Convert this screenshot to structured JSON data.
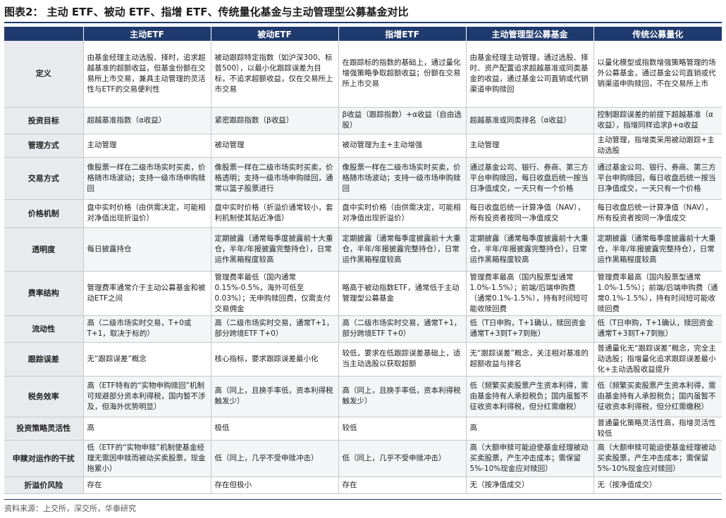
{
  "title": "图表2：  主动 ETF、被动 ETF、指增 ETF、传统量化基金与主动管理型公募基金对比",
  "columns": [
    "",
    "主动ETF",
    "被动ETF",
    "指增ETF",
    "主动管理型公募基金",
    "传统公募量化"
  ],
  "rows": [
    {
      "label": "定义",
      "cells": [
        "由基金经理主动选股、择时，追求超越基准的超额收益，但基金份额在交易所上市交易，兼具主动管理的灵活性与ETF的交易便利性",
        "被动跟踪特定指数（如沪深300、标普500），以最小化跟踪误差为目标，不追求超额收益，仅在交易所上市交易",
        "在跟踪标的指数的基础上，通过量化增强策略争取超额收益；份额在交易所上市交易",
        "由基金经理主动管理，通过选股、择时、资产配置追求超越基准或同类基金的收益，通过基金公司直销或代销渠道申购赎回",
        "以量化模型或指数增强策略管理的场外公募基金，通过基金公司直销或代销渠道申购赎回，不在交易所上市"
      ]
    },
    {
      "label": "投资目标",
      "cells": [
        "超越基准指数（α收益）",
        "紧密跟踪指数（β收益）",
        "β收益（跟踪指数）+α收益（自由选股）",
        "超越基准或同类排名（α收益）",
        "控制跟踪误差的前提下超越基准（α收益），指增同样追求β+α收益"
      ]
    },
    {
      "label": "管理方式",
      "cells": [
        "主动管理",
        "被动管理",
        "被动管理为主+主动增强",
        "主动管理",
        "主动管理，指增类采用被动跟踪+主动选股"
      ]
    },
    {
      "label": "交易方式",
      "cells": [
        "像股票一样在二级市场实时买卖，价格随市场波动；支持一级市场申购赎回",
        "像股票一样在二级市场实时买卖，价格透明；支持一级市场申购赎回，通常以篮子股票进行",
        "像股票一样在二级市场实时买卖，价格随市场波动；支持一级市场申购赎回",
        "通过基金公司、银行、券商、第三方平台申购赎回，每日收盘后统一按当日净值成交，一天只有一个价格",
        "通过基金公司、银行、券商、第三方平台申购赎回，每日收盘后统一按当日净值成交，一天只有一个价格"
      ]
    },
    {
      "label": "价格机制",
      "cells": [
        "盘中实时价格（由供需决定，可能相对净值出现折溢价）",
        "盘中实时价格（折溢价通常较小，套利机制使其贴近净值）",
        "盘中实时价格（由供需决定，可能相对净值出现折溢价）",
        "每日收盘后统一计算净值（NAV），所有投资者按同一净值成交",
        "每日收盘后统一计算净值（NAV），所有投资者按同一净值成交"
      ]
    },
    {
      "label": "透明度",
      "cells": [
        "每日披露持仓",
        "定期披露（通常每季度披露前十大重仓，半年/年报披露完整持仓），日常运作黑箱程度较高",
        "定期披露（通常每季度披露前十大重仓，半年/年报披露完整持仓），日常运作黑箱程度较高",
        "定期披露（通常每季度披露前十大重仓，半年/年报披露完整持仓），日常运作黑箱程度较高",
        "定期披露（通常每季度披露前十大重仓，半年/年报披露完整持仓），日常运作黑箱程度较高"
      ]
    },
    {
      "label": "费率结构",
      "cells": [
        "管理费率通常介于主动公募基金和被动ETF之间",
        "管理费率最低（国内通常0.15%-0.5%，海外可低至0.03%）；无申购赎回费，仅需支付交易佣金",
        "略高于被动指数ETF，通常低于主动管理型公募基金",
        "管理费率最高（国内股票型通常1.0%-1.5%）；前端/后端申购费（通常0.1%-1.5%），持有时间短可能收赎回费",
        "管理费率最高（国内股票型通常1.0%-1.5%）；前端/后端申购费（通常0.1%-1.5%），持有时间短可能收赎回费"
      ]
    },
    {
      "label": "流动性",
      "cells": [
        "高（二级市场实时交易，T+0或T+1，取决于标的）",
        "高（二级市场实时交易，通常T+1，部分跨境ETF T+0）",
        "高（二级市场实时交易，通常T+1，部分跨境ETF T+0）",
        "低（T日申购，T+1确认，赎回资金通常T+3到T+7到账）",
        "低（T日申购，T+1确认，赎回资金通常T+3到T+7到账）"
      ]
    },
    {
      "label": "跟踪误差",
      "cells": [
        "无“跟踪误差”概念",
        "核心指标，要求跟踪误差最小化",
        "较低，要求在低跟踪误差基础上，适当主动选股以获取超额",
        "无“跟踪误差”概念，关注相对基准的超额收益与排名",
        "普通量化无“跟踪误差”概念，完全主动选股；指增量化追求跟踪误差最小化+主动选股收益提升"
      ]
    },
    {
      "label": "税务效率",
      "cells": [
        "高（ETF特有的“实物申购赎回”机制可规避部分资本利得税，国内暂不涉及，但海外优势明显）",
        "高（同上，且换手率低，资本利得税触发少）",
        "高（同上，且换手率低，资本利得税触发少）",
        "低（频繁买卖股票产生资本利得，需由基金持有人承担税负；国内虽暂不征收资本利得税，但分红需缴税）",
        "低（频繁买卖股票产生资本利得，需由基金持有人承担税负；国内虽暂不征收资本利得税，但分红需缴税）"
      ]
    },
    {
      "label": "投资策略灵活性",
      "cells": [
        "高",
        "极低",
        "较低",
        "高",
        "普通量化策略灵活性高，指增灵活性较低"
      ]
    },
    {
      "label": "申赎对运作的干扰",
      "cells": [
        "低（ETF的“实物申赎”机制使基金经理无需因申赎而被动买卖股票，现金拖累小）",
        "低（同上，几乎不受申赎冲击）",
        "低（同上，几乎不受申赎冲击）",
        "高（大额申赎可能迫使基金经理被动买卖股票，产生冲击成本；需保留5%-10%现金应对赎回）",
        "高（大额申赎可能迫使基金经理被动买卖股票，产生冲击成本；需保留5%-10%现金应对赎回）"
      ]
    },
    {
      "label": "折溢价风险",
      "cells": [
        "存在",
        "存在但极小",
        "存在",
        "无（按净值成交）",
        "无（按净值成交）"
      ]
    }
  ],
  "source": "资料来源：上交所，深交所，华泰研究"
}
